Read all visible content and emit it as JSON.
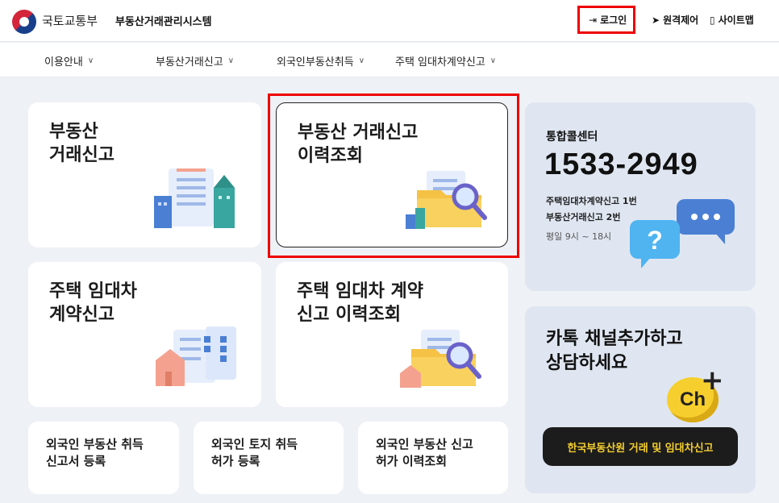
{
  "header": {
    "ministry": "국토교통부",
    "system_name": "부동산거래관리시스템",
    "login": "로그인",
    "remote": "원격제어",
    "sitemap": "사이트맵"
  },
  "nav": {
    "items": [
      {
        "label": "이용안내"
      },
      {
        "label": "부동산거래신고"
      },
      {
        "label": "외국인부동산취득"
      },
      {
        "label": "주택 임대차계약신고"
      }
    ]
  },
  "cards": {
    "realestate_report": {
      "line1": "부동산",
      "line2": "거래신고"
    },
    "report_history": {
      "line1": "부동산 거래신고",
      "line2": "이력조회"
    },
    "lease_report": {
      "line1": "주택 임대차",
      "line2": "계약신고"
    },
    "lease_history": {
      "line1": "주택 임대차 계약",
      "line2": "신고 이력조회"
    },
    "foreign_acq": {
      "line1": "외국인 부동산 취득",
      "line2": "신고서 등록"
    },
    "foreign_land": {
      "line1": "외국인 토지 취득",
      "line2": "허가 등록"
    },
    "foreign_history": {
      "line1": "외국인 부동산 신고",
      "line2": "허가 이력조회"
    }
  },
  "call_center": {
    "label": "통합콜센터",
    "phone": "1533-2949",
    "line1": "주택임대차계약신고 1번",
    "line2": "부동산거래신고 2번",
    "hours": "평일 9시 ~ 18시"
  },
  "kakao": {
    "line1": "카톡 채널추가하고",
    "line2": "상담하세요",
    "ch": "Ch",
    "button": "한국부동산원 거래 및 임대차신고"
  },
  "colors": {
    "highlight": "#ee0000",
    "kakao_yellow": "#f6cf2e",
    "panel_blue": "#dfe6f1",
    "page_bg": "#eef1f6"
  }
}
